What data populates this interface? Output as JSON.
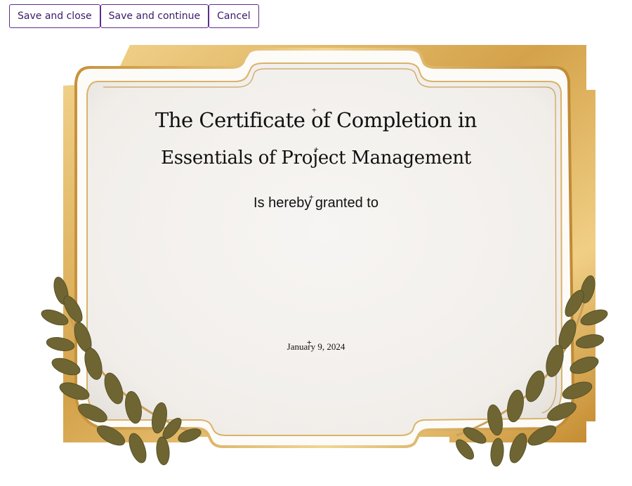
{
  "toolbar": {
    "save_close_label": "Save and close",
    "save_continue_label": "Save and continue",
    "cancel_label": "Cancel"
  },
  "certificate": {
    "title": "The Certificate of Completion in",
    "course": "Essentials of Project Management",
    "granted": "Is hereby granted to",
    "recipient": "",
    "date": "January 9, 2024"
  },
  "colors": {
    "accent": "#5c2d91",
    "gold": "#d4a24a",
    "paper": "#f6f4f1",
    "leaf": "#6f6533"
  }
}
